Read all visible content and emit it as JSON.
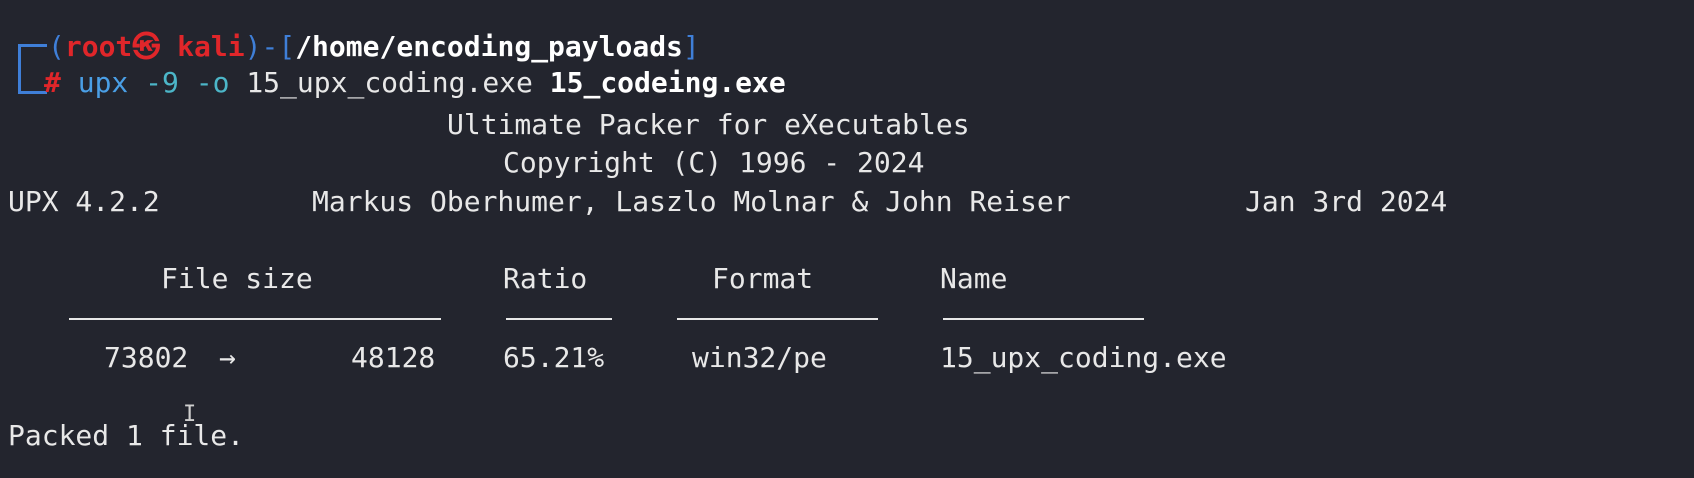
{
  "prompt": {
    "open_paren": "(",
    "user": "root",
    "symbol": "㉿",
    "host": "kali",
    "close_paren": ")",
    "dash": "-[",
    "path": "/home/encoding_payloads",
    "close_bracket": "]",
    "hash": "#"
  },
  "command": {
    "name": "upx",
    "args": "-9 -o",
    "output_file": "15_upx_coding.exe",
    "input_file": "15_codeing.exe"
  },
  "banner": {
    "title": "Ultimate Packer for eXecutables",
    "copyright": "Copyright (C) 1996 - 2024",
    "version": "UPX 4.2.2",
    "authors": "Markus Oberhumer, Laszlo Molnar & John Reiser",
    "date": "Jan 3rd 2024"
  },
  "table": {
    "headers": {
      "file_size": "File size",
      "ratio": "Ratio",
      "format": "Format",
      "name": "Name"
    },
    "rows": [
      {
        "original": "73802",
        "arrow": "→",
        "packed": "48128",
        "ratio": "65.21%",
        "format": "win32/pe",
        "name": "15_upx_coding.exe"
      }
    ]
  },
  "summary": "Packed 1 file.",
  "colors": {
    "background": "#23252e",
    "prompt_blue": "#3f7fd8",
    "prompt_red": "#e0262a",
    "command_blue": "#4a9fe6"
  },
  "icons": {
    "cursor": "text-cursor-icon"
  }
}
